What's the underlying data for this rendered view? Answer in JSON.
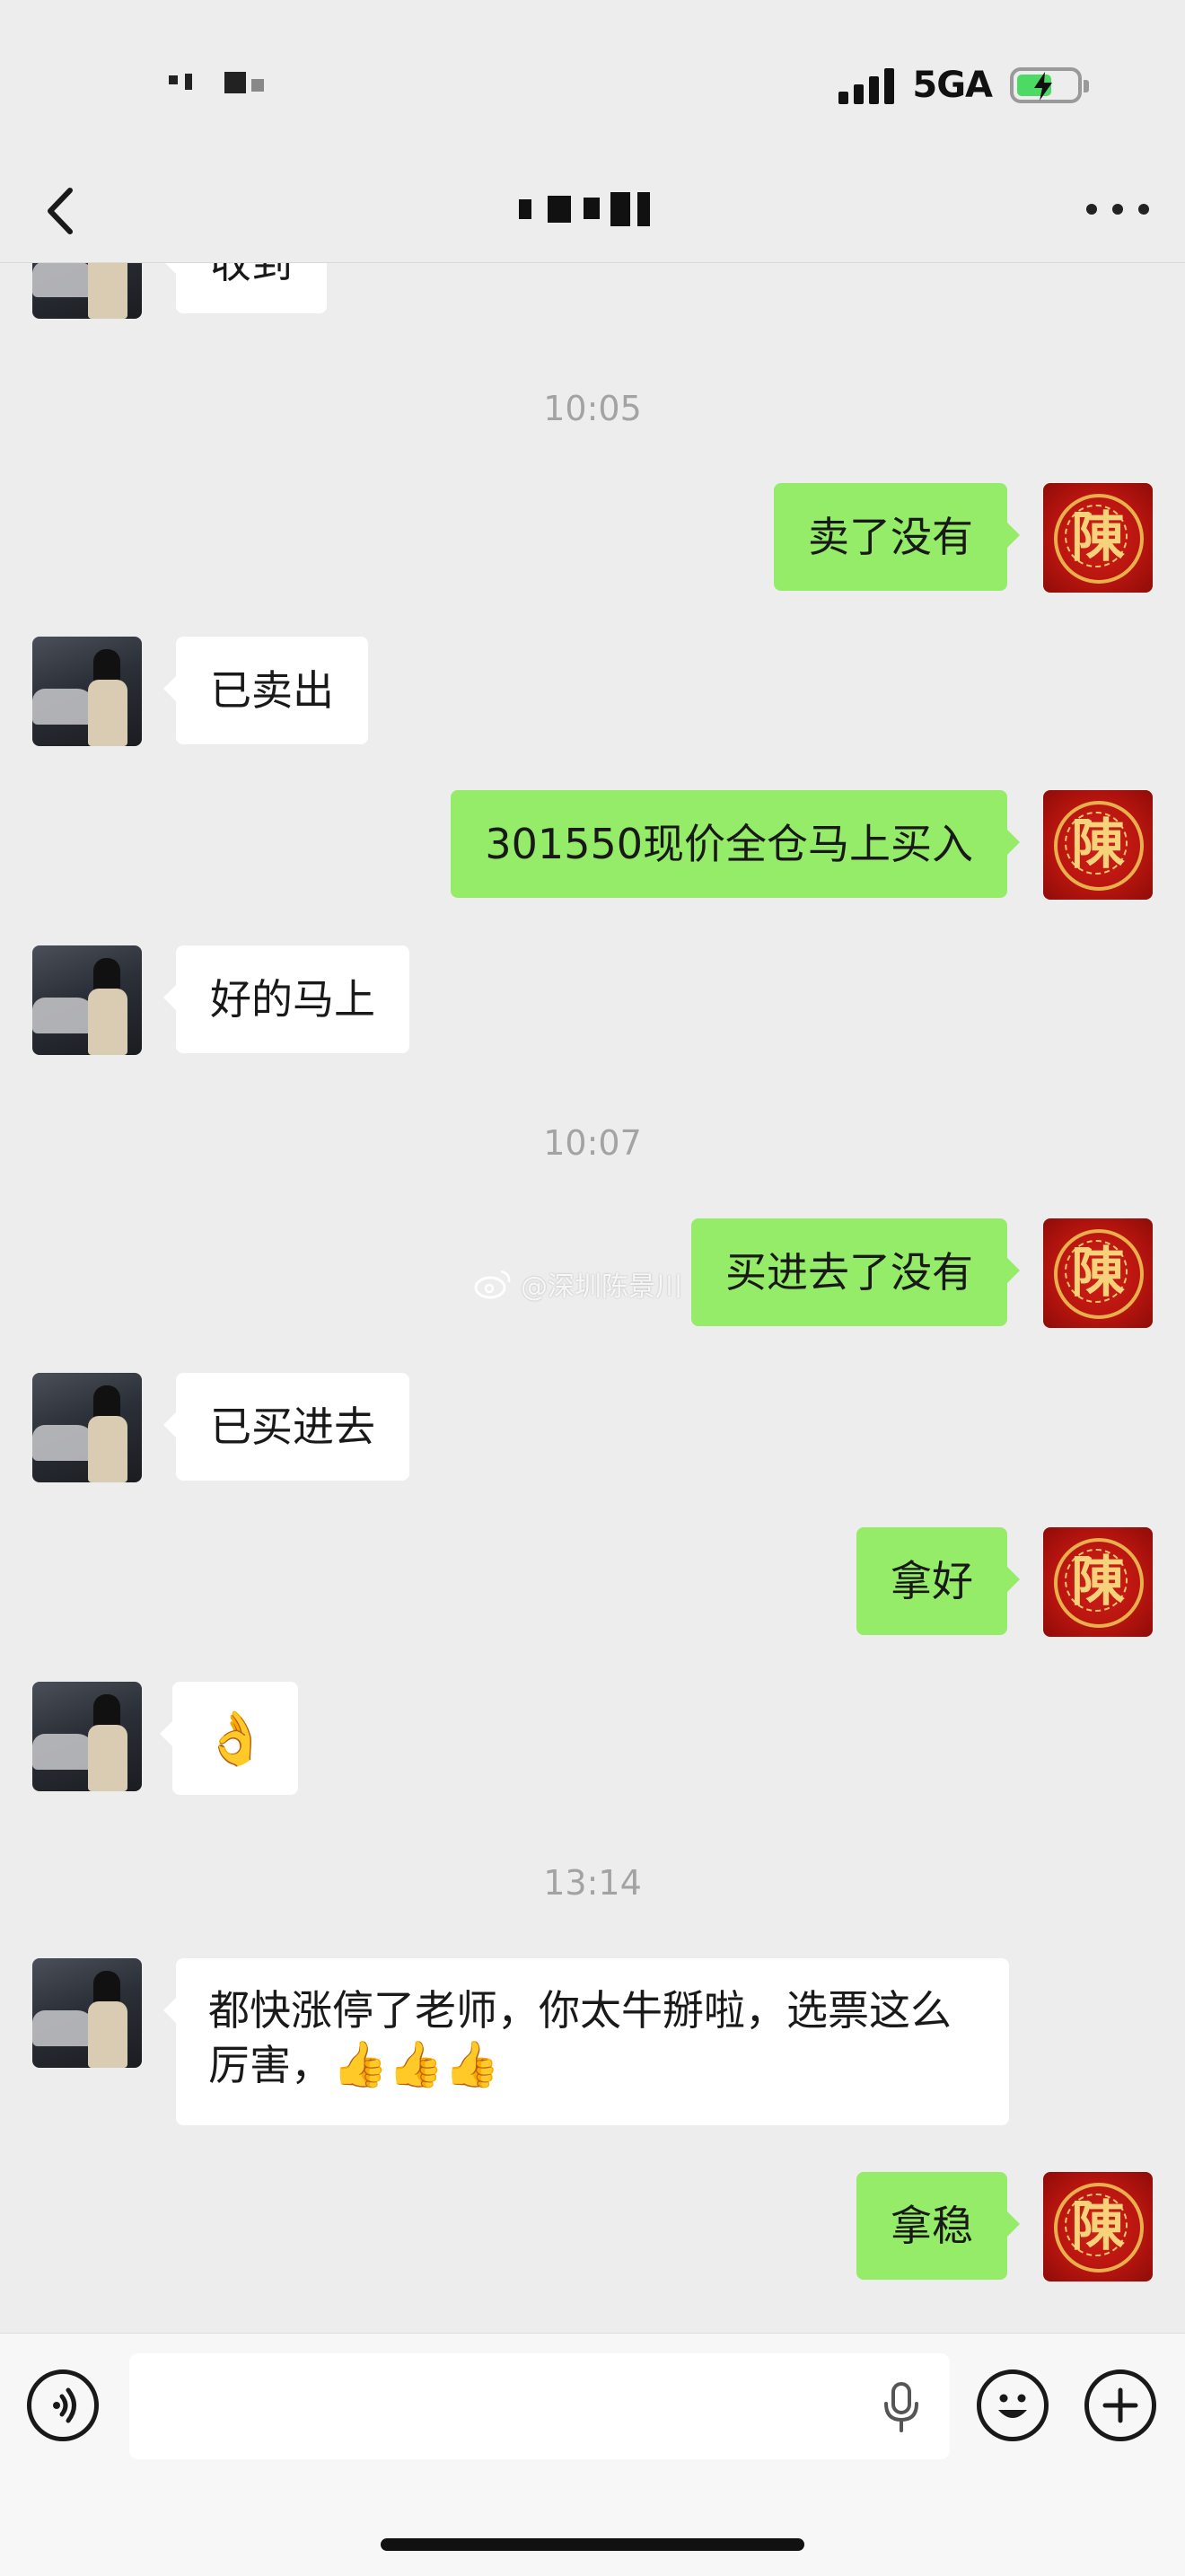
{
  "status_bar": {
    "network": "5GA",
    "signal_bars": 4,
    "battery_charging": true
  },
  "nav": {
    "back_icon": "chevron-left-icon",
    "more_icon": "more-dots-icon"
  },
  "timestamps": [
    "10:05",
    "10:07",
    "13:14"
  ],
  "messages": [
    {
      "side": "in",
      "text": "收到"
    },
    {
      "side": "out",
      "text": "卖了没有"
    },
    {
      "side": "in",
      "text": "已卖出"
    },
    {
      "side": "out",
      "text": "301550现价全仓马上买入"
    },
    {
      "side": "in",
      "text": "好的马上"
    },
    {
      "side": "out",
      "text": "买进去了没有"
    },
    {
      "side": "in",
      "text": "已买进去"
    },
    {
      "side": "out",
      "text": "拿好"
    },
    {
      "side": "in",
      "text": "👌"
    },
    {
      "side": "in",
      "text": "都快涨停了老师，你太牛掰啦，选票这么厉害，",
      "emoji": "👍👍👍"
    },
    {
      "side": "out",
      "text": "拿稳"
    }
  ],
  "avatar_me_glyph": "陳",
  "watermark": "@深圳陈景川",
  "input_bar": {
    "voice_icon": "voice-icon",
    "mic_icon": "microphone-icon",
    "emoji_icon": "smiley-icon",
    "plus_icon": "plus-icon"
  },
  "colors": {
    "background": "#ededed",
    "bubble_out": "#95ec69",
    "bubble_in": "#ffffff",
    "timestamp": "#a3a3a3"
  }
}
